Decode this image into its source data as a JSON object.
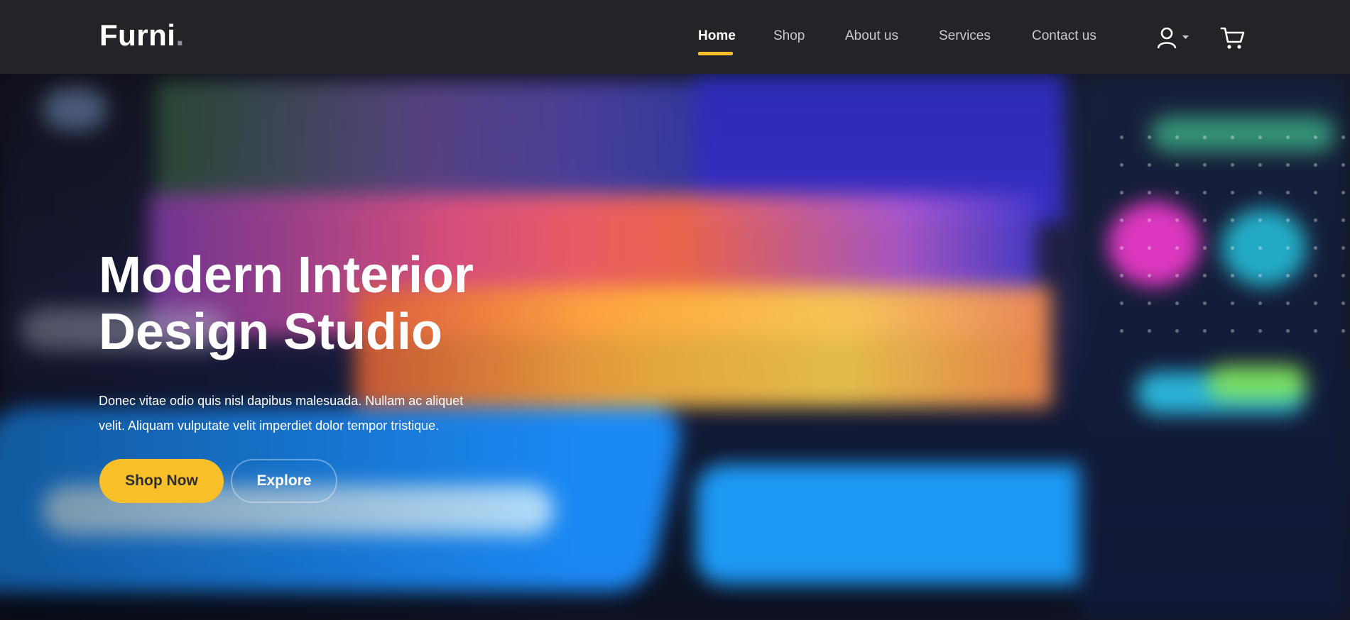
{
  "brand": {
    "name": "Furni",
    "dot": "."
  },
  "nav": {
    "items": [
      {
        "label": "Home",
        "active": true
      },
      {
        "label": "Shop",
        "active": false
      },
      {
        "label": "About us",
        "active": false
      },
      {
        "label": "Services",
        "active": false
      },
      {
        "label": "Contact us",
        "active": false
      }
    ],
    "icons": {
      "user": "user-icon",
      "dropdown": "caret-down-icon",
      "cart": "cart-icon"
    }
  },
  "hero": {
    "title_line1": "Modern Interior",
    "title_line2": "Design Studio",
    "text_line1": "Donec vitae odio quis nisl dapibus malesuada. Nullam ac aliquet",
    "text_line2": "velit. Aliquam vulputate velit imperdiet dolor tempor tristique.",
    "primary_button": "Shop Now",
    "secondary_button": "Explore"
  },
  "colors": {
    "navbar": "#222427",
    "accent": "#f9bf29",
    "text": "#ffffff",
    "nav_inactive": "#c9cbcf"
  }
}
